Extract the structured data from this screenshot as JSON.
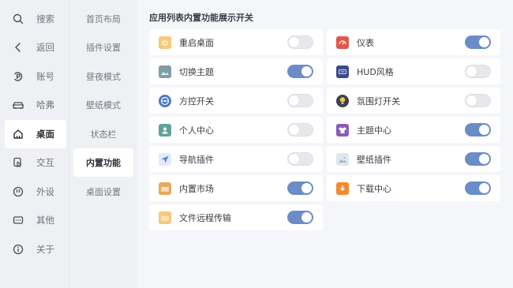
{
  "nav": {
    "items": [
      {
        "label": "搜索",
        "icon": "search-icon"
      },
      {
        "label": "返回",
        "icon": "back-icon"
      },
      {
        "label": "账号",
        "icon": "account-icon"
      },
      {
        "label": "哈弗",
        "icon": "car-icon"
      },
      {
        "label": "桌面",
        "icon": "home-icon",
        "active": true
      },
      {
        "label": "交互",
        "icon": "interaction-icon"
      },
      {
        "label": "外设",
        "icon": "peripheral-icon"
      },
      {
        "label": "其他",
        "icon": "other-icon"
      },
      {
        "label": "关于",
        "icon": "info-icon"
      }
    ]
  },
  "submenu": {
    "items": [
      {
        "label": "首页布局"
      },
      {
        "label": "插件设置"
      },
      {
        "label": "昼夜模式"
      },
      {
        "label": "壁纸模式"
      },
      {
        "label": "状态栏"
      },
      {
        "label": "内置功能",
        "active": true
      },
      {
        "label": "桌面设置"
      }
    ]
  },
  "main": {
    "title": "应用列表内置功能展示开关",
    "left": [
      {
        "label": "重启桌面",
        "on": false,
        "icon": "restart-icon",
        "color": "#f7c97a"
      },
      {
        "label": "切换主题",
        "on": true,
        "icon": "theme-icon",
        "color": "#7e9ea6"
      },
      {
        "label": "方控开关",
        "on": false,
        "icon": "steering-wheel-icon",
        "color": "#4a78c8"
      },
      {
        "label": "个人中心",
        "on": false,
        "icon": "user-icon",
        "color": "#5fa39b"
      },
      {
        "label": "导航插件",
        "on": false,
        "icon": "navigation-icon",
        "color": "#d9e4fb"
      },
      {
        "label": "内置市场",
        "on": true,
        "icon": "market-icon",
        "color": "#e9a95b"
      },
      {
        "label": "文件远程传输",
        "on": true,
        "icon": "folder-icon",
        "color": "#f6c77a"
      }
    ],
    "right": [
      {
        "label": "仪表",
        "on": true,
        "icon": "dashboard-icon",
        "color": "#e2574c"
      },
      {
        "label": "HUD风格",
        "on": false,
        "icon": "hud-icon",
        "color": "#3c4c8a"
      },
      {
        "label": "氛围灯开关",
        "on": false,
        "icon": "lightbulb-icon",
        "color": "#3b4250"
      },
      {
        "label": "主题中心",
        "on": true,
        "icon": "shirt-icon",
        "color": "#8c5bb8"
      },
      {
        "label": "壁纸插件",
        "on": true,
        "icon": "image-icon",
        "color": "#dfe6ee"
      },
      {
        "label": "下载中心",
        "on": true,
        "icon": "download-icon",
        "color": "#f28a2e"
      }
    ]
  }
}
